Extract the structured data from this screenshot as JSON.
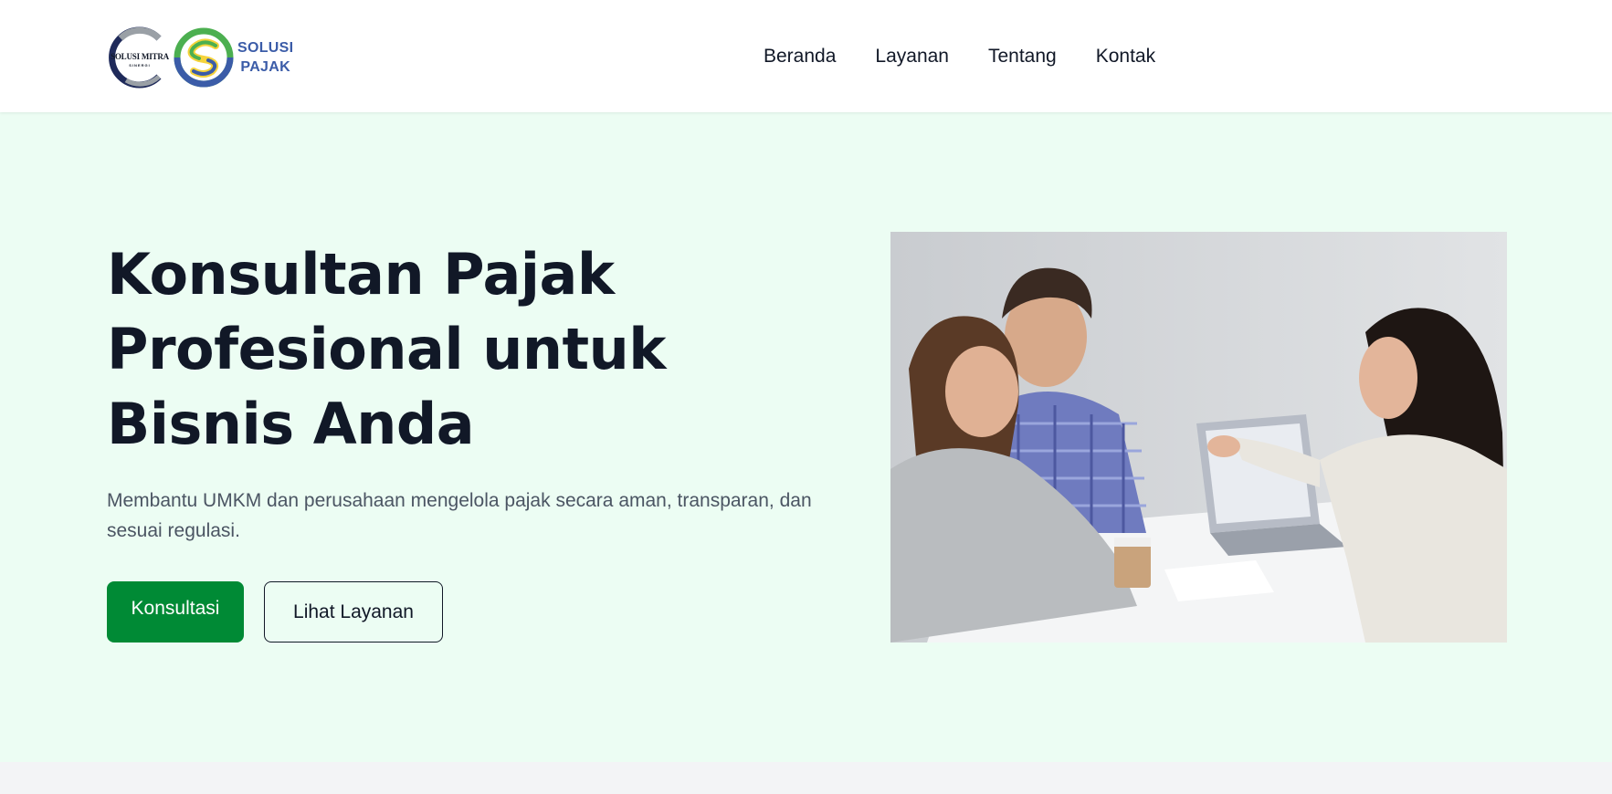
{
  "brand": {
    "logo_primary_text": "SOLUSI MITRA",
    "logo_primary_subtext": "SINERGI",
    "logo_secondary_line1": "SOLUSI",
    "logo_secondary_line2": "PAJAK"
  },
  "nav": {
    "items": [
      "Beranda",
      "Layanan",
      "Tentang",
      "Kontak"
    ]
  },
  "hero": {
    "title": "Konsultan Pajak Profesional untuk Bisnis Anda",
    "subtitle": "Membantu UMKM dan perusahaan mengelola pajak secara aman, transparan, dan sesuai regulasi.",
    "primary_button": "Konsultasi",
    "secondary_button": "Lihat Layanan"
  },
  "colors": {
    "hero_background": "#ecfdf3",
    "primary_button": "#008a35",
    "title_text": "#111827",
    "body_text": "#4b5563",
    "logo_blue": "#3b5ca8",
    "logo_green": "#4caf50",
    "logo_yellow": "#f5d33b"
  },
  "icons": {
    "logo_primary": "solusi-mitra-sinergi-logo",
    "logo_secondary": "solusi-pajak-logo"
  }
}
